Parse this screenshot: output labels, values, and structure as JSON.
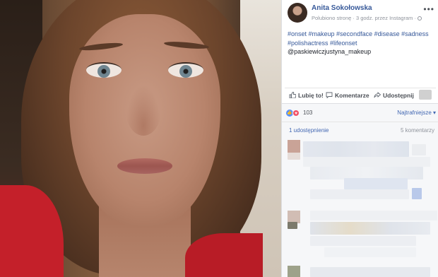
{
  "post": {
    "author": "Anita Sokołowska",
    "meta": "Polubiono stronę · 3 godz. przez Instagram ·",
    "more": "•••",
    "caption_tags": "#onset #makeup #secondface #disease #sadness #polishactress #lifeonset",
    "caption_mention": "@paskiewiczjustyna_makeup"
  },
  "actions": {
    "like": "Lubię to!",
    "comment": "Komentarze",
    "share": "Udostępnij"
  },
  "reactions": {
    "count": "103",
    "sort": "Najtrafniejsze ▾"
  },
  "stats": {
    "shares": "1 udostępnienie",
    "comments": "5 komentarzy"
  },
  "icons": {
    "like": "thumbs-up-icon",
    "comment": "comment-icon",
    "share": "share-icon",
    "globe": "globe-icon"
  },
  "colors": {
    "link": "#365899",
    "like_reaction": "#5890ff",
    "love_reaction": "#f25268"
  }
}
